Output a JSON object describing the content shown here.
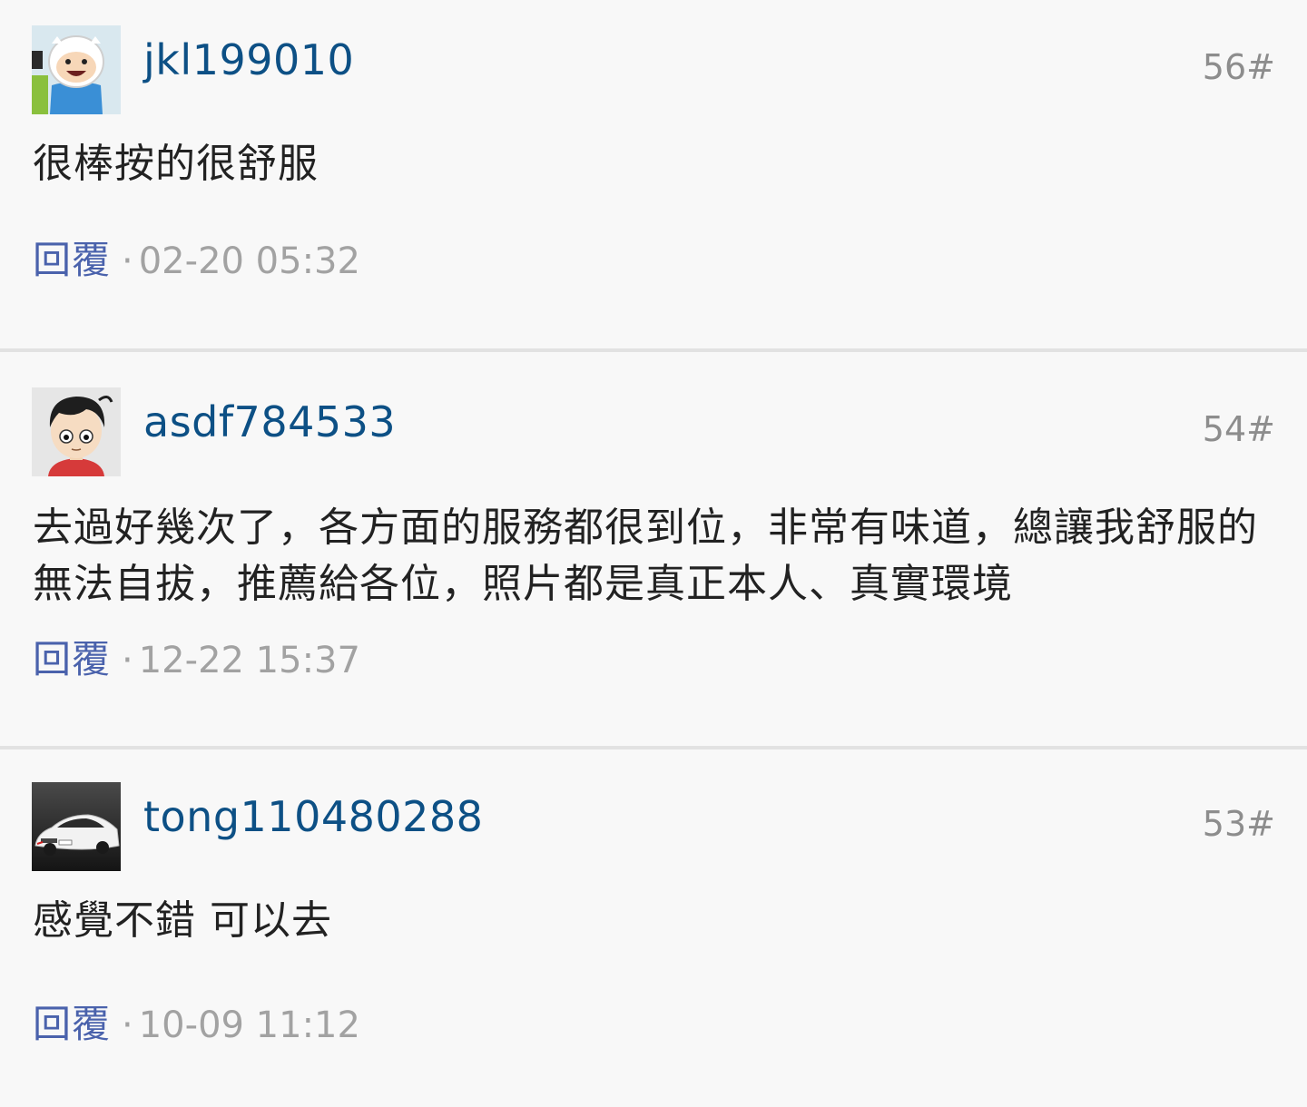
{
  "comments": [
    {
      "username": "jkl199010",
      "floor": "56#",
      "text": "很棒按的很舒服",
      "reply_label": "回覆",
      "separator": "·",
      "timestamp": "02-20 05:32",
      "avatar": "cartoon-boy-avatar"
    },
    {
      "username": "asdf784533",
      "floor": "54#",
      "text": "去過好幾次了，各方面的服務都很到位，非常有味道，總讓我舒服的無法自拔，推薦給各位，照片都是真正本人、真實環境",
      "reply_label": "回覆",
      "separator": "·",
      "timestamp": "12-22 15:37",
      "avatar": "cartoon-face-avatar"
    },
    {
      "username": "tong110480288",
      "floor": "53#",
      "text": "感覺不錯 可以去",
      "reply_label": "回覆",
      "separator": "·",
      "timestamp": "10-09 11:12",
      "avatar": "car-photo-avatar"
    }
  ],
  "colors": {
    "username": "#0d5085",
    "reply": "#4a62ac",
    "meta": "#a2a2a2",
    "floor": "#8d8d8d",
    "divider": "#e2e2e2",
    "background": "#f8f8f8"
  }
}
